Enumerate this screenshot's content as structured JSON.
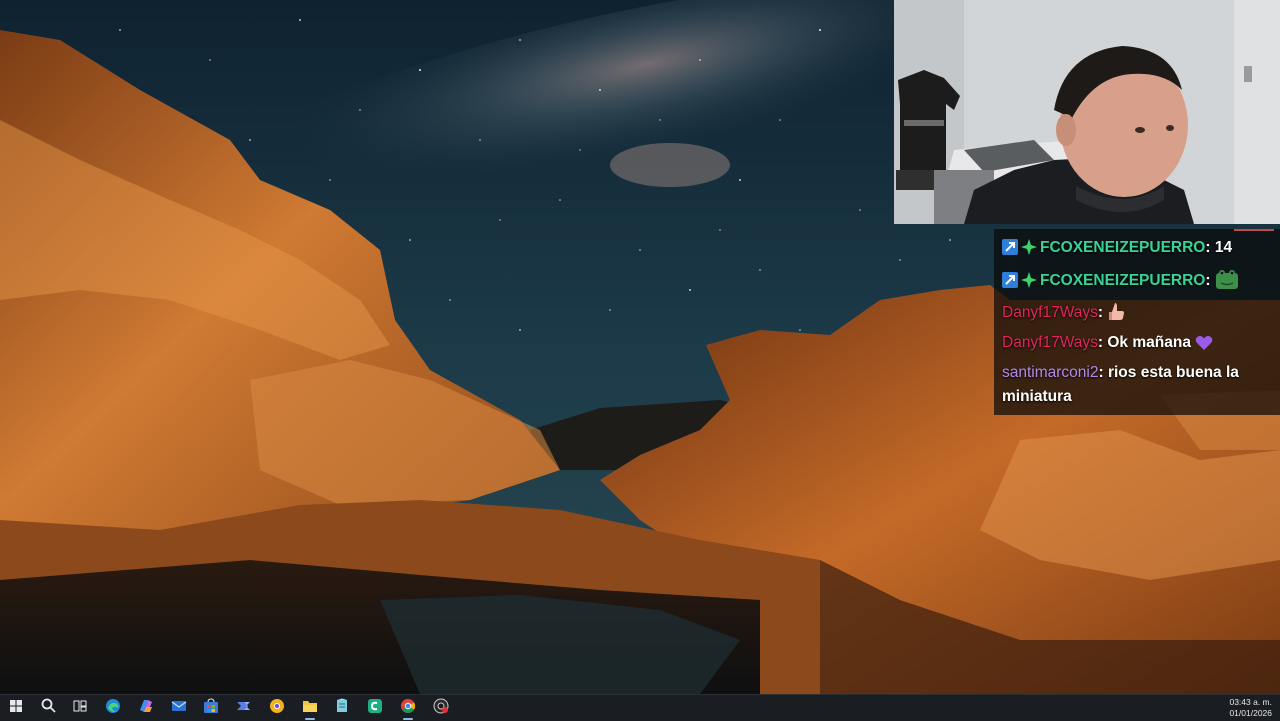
{
  "chat": {
    "messages": [
      {
        "user": "FCOXENEIZEPUERRO",
        "user_color": "#3ad296",
        "text": ": 14",
        "badges": [
          "prime-badge",
          "sparkle-badge"
        ],
        "emote": ""
      },
      {
        "user": "FCOXENEIZEPUERRO",
        "user_color": "#3ad296",
        "text": ":",
        "badges": [
          "prime-badge",
          "sparkle-badge"
        ],
        "emote": "frog-emote"
      },
      {
        "user": "Danyf17Ways",
        "user_color": "#e0265a",
        "text": ":",
        "badges": [],
        "emote": "thumb-emote"
      },
      {
        "user": "Danyf17Ways",
        "user_color": "#e0265a",
        "text": ": Ok mañana",
        "badges": [],
        "emote": "purple-heart-emote"
      },
      {
        "user": "santimarconi2",
        "user_color": "#b38ae6",
        "text": ": rios esta buena la miniatura",
        "badges": [],
        "emote": ""
      }
    ]
  },
  "taskbar": {
    "items": [
      {
        "name": "start-button",
        "icon": "windows-logo-icon",
        "running": false
      },
      {
        "name": "search-button",
        "icon": "search-icon",
        "running": false
      },
      {
        "name": "task-view-button",
        "icon": "task-view-icon",
        "running": false
      },
      {
        "name": "edge-button",
        "icon": "edge-icon",
        "running": false
      },
      {
        "name": "copilot-button",
        "icon": "copilot-icon",
        "running": false
      },
      {
        "name": "mail-button",
        "icon": "mail-icon",
        "running": false
      },
      {
        "name": "store-button",
        "icon": "store-icon",
        "running": false
      },
      {
        "name": "power-automate-button",
        "icon": "power-automate-icon",
        "running": false
      },
      {
        "name": "chromium-app-button",
        "icon": "yellow-browser-icon",
        "running": false
      },
      {
        "name": "file-explorer-button",
        "icon": "folder-icon",
        "running": true
      },
      {
        "name": "notes-button",
        "icon": "notepad-icon",
        "running": false
      },
      {
        "name": "clipchamp-button",
        "icon": "green-app-icon",
        "running": false
      },
      {
        "name": "chrome-button",
        "icon": "chrome-icon",
        "running": true
      },
      {
        "name": "obs-button",
        "icon": "record-icon",
        "running": false
      }
    ],
    "clock": {
      "time": "03:43 a. m.",
      "date": "01/01/2026"
    }
  },
  "colors": {
    "taskbar_bg": "#1a1d21",
    "chat_bg": "#0a0a0a",
    "accent": "#8fb8e8"
  }
}
